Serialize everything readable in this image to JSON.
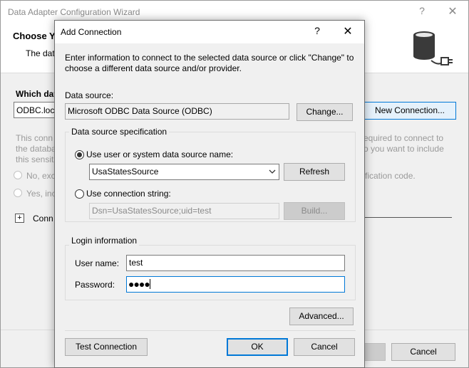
{
  "wizard": {
    "title": "Data Adapter Configuration Wizard",
    "help_glyph": "?",
    "close_glyph": "✕",
    "heading": "Choose Y",
    "subheading": "The dat",
    "which_label": "Which dat",
    "connection_combo": "ODBC.loca",
    "new_connection_label": "New Connection...",
    "para_left": [
      "This conn",
      "the databa",
      "this sensiti"
    ],
    "para_right": [
      "equired to connect to",
      "o you want to include"
    ],
    "radio_no": "No, exc",
    "radio_yes": "Yes, inc",
    "radio_right_text": "fication code.",
    "expand_glyph": "+",
    "connection_label": "Conn",
    "cancel_label": "Cancel"
  },
  "dialog": {
    "title": "Add Connection",
    "help_glyph": "?",
    "close_glyph": "✕",
    "instructions": "Enter information to connect to the selected data source or click \"Change\" to choose a different data source and/or provider.",
    "data_source_label": "Data source:",
    "data_source_value": "Microsoft ODBC Data Source (ODBC)",
    "change_label": "Change...",
    "spec_group_label": "Data source specification",
    "use_dsn_label": "Use user or system data source name:",
    "dsn_value": "UsaStatesSource",
    "refresh_label": "Refresh",
    "use_conn_string_label": "Use connection string:",
    "conn_string_value": "Dsn=UsaStatesSource;uid=test",
    "build_label": "Build...",
    "login_group_label": "Login information",
    "username_label": "User name:",
    "username_value": "test",
    "password_label": "Password:",
    "password_mask": "●●●●",
    "advanced_label": "Advanced...",
    "test_connection_label": "Test Connection",
    "ok_label": "OK",
    "cancel_label": "Cancel"
  },
  "colors": {
    "accent": "#0078d7",
    "window_bg": "#f0f0f0",
    "button_bg": "#e1e1e1"
  }
}
